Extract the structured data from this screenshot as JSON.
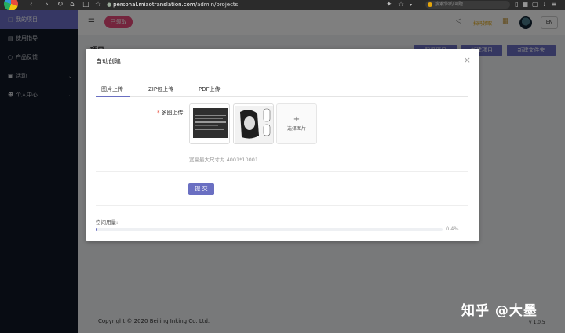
{
  "browser": {
    "url_prefix": "",
    "url_host": "personal.miaotranslation.com",
    "url_path": "/admin/projects",
    "search_placeholder": "搜索你的问题"
  },
  "sidebar": {
    "items": [
      {
        "label": "我的项目",
        "icon": "folder-icon"
      },
      {
        "label": "使用指导",
        "icon": "document-icon"
      },
      {
        "label": "产品反馈",
        "icon": "feedback-icon"
      },
      {
        "label": "活动",
        "icon": "gift-icon"
      },
      {
        "label": "个人中心",
        "icon": "user-icon"
      }
    ]
  },
  "header": {
    "pill_label": "已领取",
    "scan_label": "扫码领取",
    "lang": "EN"
  },
  "page": {
    "title": "项目",
    "actions": [
      "翻译项目",
      "新建项目",
      "新建文件夹"
    ]
  },
  "modal": {
    "title": "自动创建",
    "tabs": [
      "图片上传",
      "ZIP包上传",
      "PDF上传"
    ],
    "field_label": "多图上传:",
    "required_mark": "*",
    "upload_plus": "+",
    "upload_label": "选择图片",
    "hint": "宽高最大尺寸为 4001*10001",
    "submit_label": "提 交",
    "storage_label": "空间用量:",
    "storage_percent_text": "0.4%",
    "storage_percent": 0.4
  },
  "footer": {
    "copyright": "Copyright © 2020 Beijing Inking Co. Ltd.",
    "version": "v 1.0.5",
    "watermark": "知乎 @大墨"
  },
  "colors": {
    "accent": "#6a6fc2",
    "pill": "#e84b7a",
    "sidebar": "#111826"
  }
}
